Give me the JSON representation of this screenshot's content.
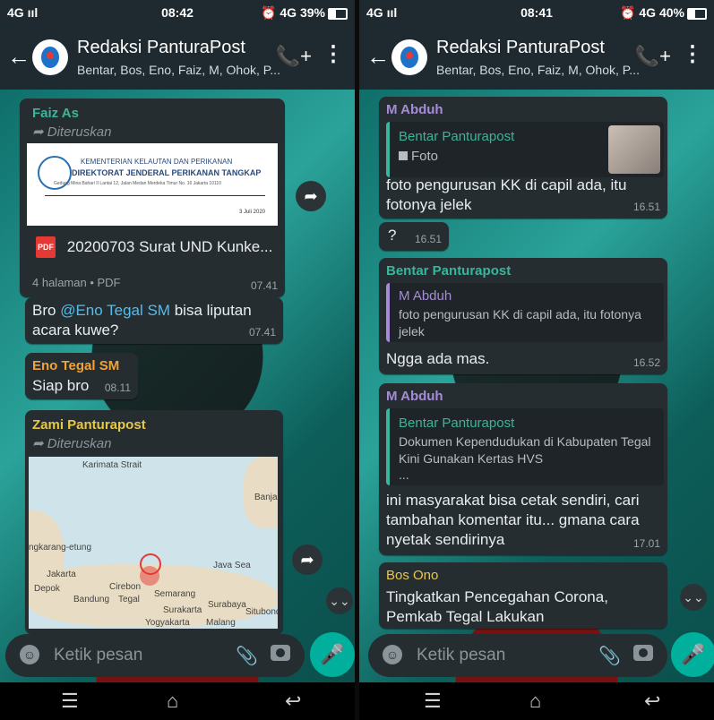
{
  "left": {
    "status": {
      "signal": "4G ııl",
      "time": "08:42",
      "right": "⏰ 4G 39%"
    },
    "header": {
      "title": "Redaksi PanturaPost",
      "subtitle": "Bentar, Bos, Eno, Faiz, M, Ohok, P..."
    },
    "messages": {
      "m1": {
        "sender": "Faiz As",
        "forwarded": "Diteruskan",
        "doc_org": "KEMENTERIAN KELAUTAN DAN PERIKANAN",
        "doc_title": "DIREKTORAT JENDERAL PERIKANAN TANGKAP",
        "doc_addr": "Gedung Mina Bahari II Lantai 12, Jalan Medan Merdeka Timur No. 16 Jakarta 10110",
        "doc_date": "3 Juli 2020",
        "file_icon": "PDF",
        "file_name": "20200703 Surat UND Kunke...",
        "meta": "4 halaman • PDF",
        "time": "07.41"
      },
      "m2": {
        "text_pre": "Bro ",
        "mention": "@Eno Tegal SM",
        "text_post": " bisa liputan acara kuwe?",
        "time": "07.41"
      },
      "m3": {
        "sender": "Eno Tegal SM",
        "text": "Siap bro",
        "time": "08.11"
      },
      "m4": {
        "sender": "Zami Panturapost",
        "forwarded": "Diteruskan",
        "map_labels": [
          "Karimata Strait",
          "Banjar",
          "Java Sea",
          "Jakarta",
          "Cirebon",
          "Bandung",
          "Tegal",
          "Semarang",
          "Surakarta",
          "Surabaya",
          "Yogyakarta",
          "Malang",
          "ngkarang-etung",
          "Depok",
          "Situbondo"
        ]
      }
    },
    "input": {
      "placeholder": "Ketik pesan"
    }
  },
  "right": {
    "status": {
      "signal": "4G ııl",
      "time": "08:41",
      "right": "⏰ 4G 40%"
    },
    "header": {
      "title": "Redaksi PanturaPost",
      "subtitle": "Bentar, Bos, Eno, Faiz, M, Ohok, P..."
    },
    "messages": {
      "r1": {
        "sender": "M Abduh",
        "quote_sender": "Bentar Panturapost",
        "quote_text": "Foto",
        "text": "foto pengurusan KK di capil ada, itu fotonya jelek",
        "time": "16.51"
      },
      "r2": {
        "text": "?",
        "time": "16.51"
      },
      "r3": {
        "sender": "Bentar Panturapost",
        "quote_sender": "M Abduh",
        "quote_text": "foto pengurusan KK di capil ada, itu fotonya jelek",
        "text": "Ngga ada mas.",
        "time": "16.52"
      },
      "r4": {
        "sender": "M Abduh",
        "quote_sender": "Bentar Panturapost",
        "quote_text": "Dokumen Kependudukan di Kabupaten Tegal Kini Gunakan Kertas HVS",
        "quote_more": "...",
        "text": "ini masyarakat bisa cetak sendiri, cari tambahan komentar itu... gmana cara nyetak sendirinya",
        "time": "17.01"
      },
      "r5": {
        "sender": "Bos Ono",
        "text": "Tingkatkan Pencegahan Corona, Pemkab Tegal Lakukan"
      }
    },
    "input": {
      "placeholder": "Ketik pesan"
    }
  },
  "icons": {
    "back": "←",
    "call": "📞+",
    "menu": "⋮",
    "forward": "➦",
    "scroll_down": "⌄⌄",
    "mic": "🎤",
    "nav_menu": "☰",
    "nav_home": "⌂",
    "nav_back": "↩"
  }
}
